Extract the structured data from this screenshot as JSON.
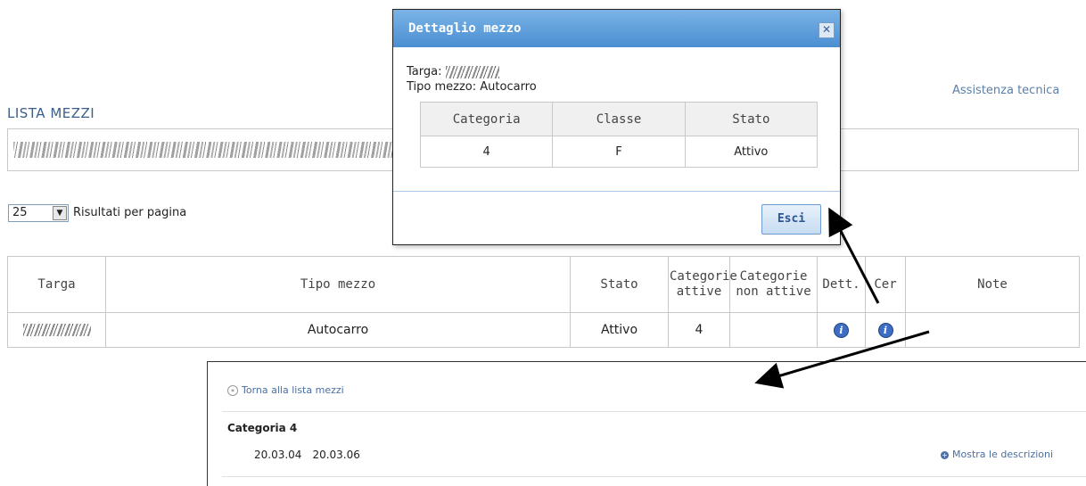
{
  "header": {
    "title": "LISTA MEZZI",
    "assist_link": "Assistenza tecnica"
  },
  "pagination": {
    "per_page_value": "25",
    "per_page_label": "Risultati per pagina"
  },
  "table": {
    "headers": [
      "Targa",
      "Tipo mezzo",
      "Stato",
      "Categorie attive",
      "Categorie non attive",
      "Dett.",
      "Cer",
      "Note"
    ],
    "rows": [
      {
        "tipo": "Autocarro",
        "stato": "Attivo",
        "attive": "4",
        "non_attive": "",
        "note": ""
      }
    ]
  },
  "dialog": {
    "title": "Dettaglio mezzo",
    "targa_label": "Targa:",
    "tipo_text": "Tipo mezzo: Autocarro",
    "headers": [
      "Categoria",
      "Classe",
      "Stato"
    ],
    "row": {
      "categoria": "4",
      "classe": "F",
      "stato": "Attivo"
    },
    "esc_label": "Esci",
    "close_icon": "close-icon"
  },
  "detail": {
    "back_link": "Torna alla lista mezzi",
    "category_title": "Categoria 4",
    "codes": [
      "20.03.04",
      "20.03.06"
    ],
    "show_desc": "Mostra le descrizioni"
  },
  "colors": {
    "accent": "#3a5f8a",
    "dialog_header": "#5b9bd9",
    "link": "#4a6fa0"
  }
}
